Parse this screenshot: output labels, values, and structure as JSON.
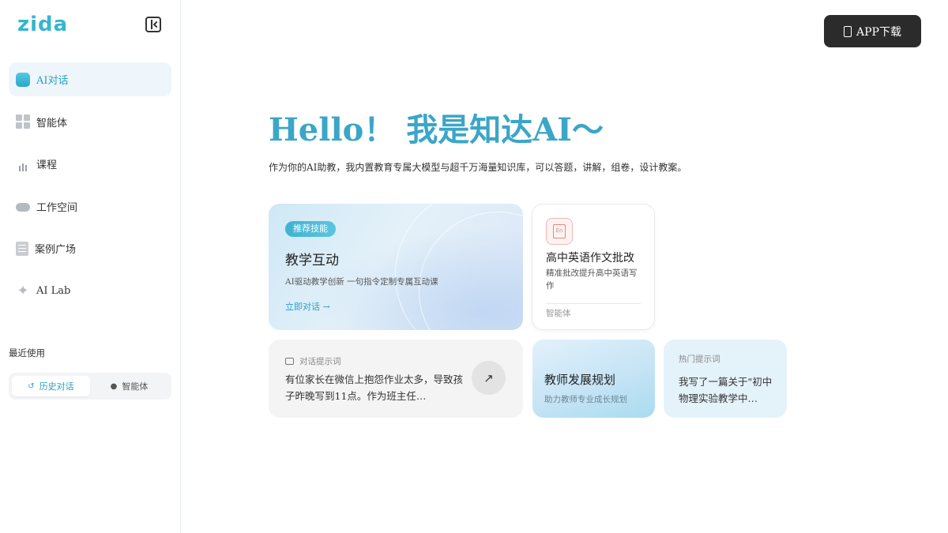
{
  "sidebar": {
    "logo": "zida",
    "items": [
      {
        "label": "AI对话",
        "icon": "chat-bubble-icon",
        "active": true
      },
      {
        "label": "智能体",
        "icon": "grid-icon"
      },
      {
        "label": "课程",
        "icon": "course-bars-icon"
      },
      {
        "label": "工作空间",
        "icon": "cloud-icon"
      },
      {
        "label": "案例广场",
        "icon": "document-list-icon"
      },
      {
        "label": "AI Lab",
        "icon": "sparkle-icon"
      }
    ],
    "recent_label": "最近使用",
    "tabs": [
      {
        "label": "历史对话",
        "icon": "history-icon",
        "active": true
      },
      {
        "label": "智能体",
        "icon": "agent-icon"
      }
    ]
  },
  "header": {
    "app_download": "APP下载"
  },
  "hero": {
    "title": "Hello！ 我是知达AI～",
    "subtitle": "作为你的AI助教，我内置教育专属大模型与超千万海量知识库，可以答题，讲解，组卷，设计教案。"
  },
  "cards": {
    "teaching": {
      "badge": "推荐技能",
      "title": "教学互动",
      "desc": "AI驱动教学创新 一句指令定制专属互动课",
      "link": "立即对话 →"
    },
    "essay": {
      "title": "高中英语作文批改",
      "desc": "精准批改提升高中英语写作",
      "tag": "智能体"
    },
    "prompt": {
      "label": "对话提示词",
      "text": "有位家长在微信上抱怨作业太多，导致孩子昨晚写到11点。作为班主任…",
      "arrow": "↗"
    },
    "plan": {
      "title": "教师发展规划",
      "desc": "助力教师专业成长规划"
    },
    "hot": {
      "label": "热门提示词",
      "text": "我写了一篇关于\"初中物理实验教学中…"
    }
  },
  "colors": {
    "accent": "#3aa6c8",
    "button_dark": "#2b2b2b"
  }
}
